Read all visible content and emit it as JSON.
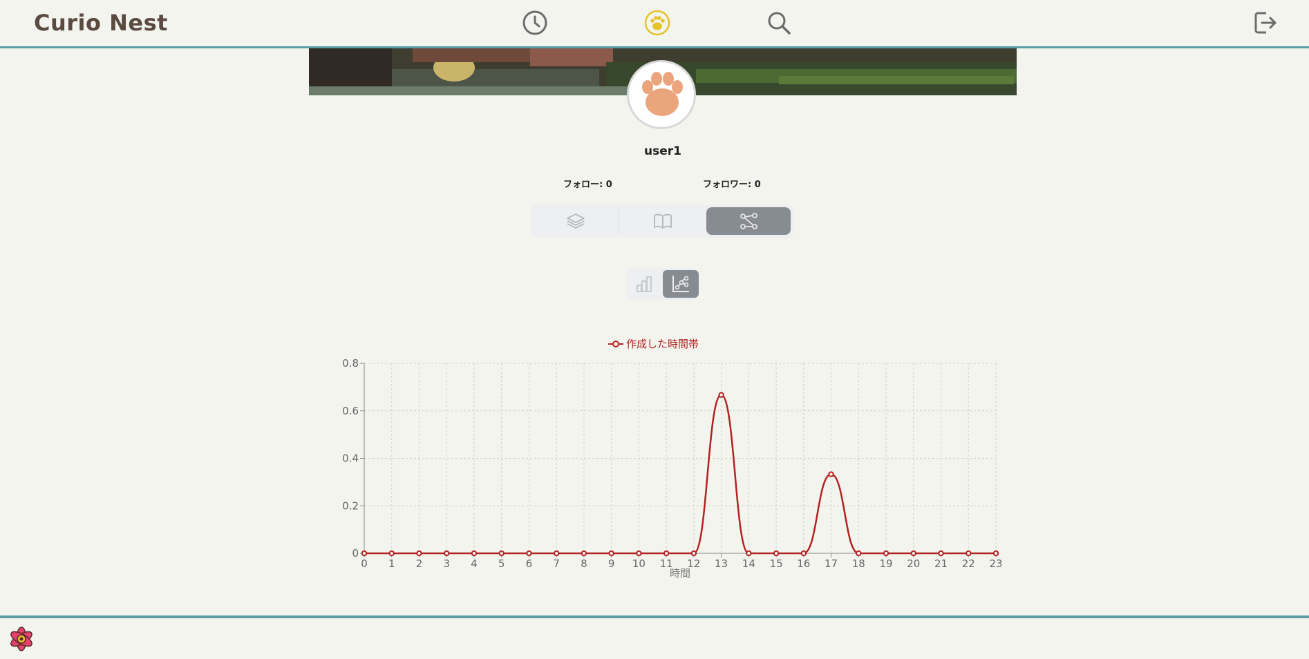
{
  "header": {
    "brand": "Curio Nest",
    "nav": {
      "history_icon": "clock-icon",
      "profile_icon": "paw-icon",
      "search_icon": "search-icon",
      "logout_icon": "logout-icon",
      "active_color": "#e6c229",
      "icon_color": "#6b6b6b"
    }
  },
  "profile": {
    "username": "user1",
    "follow_label": "フォロー: 0",
    "follower_label": "フォロワー: 0",
    "avatar_icon": "paw-icon",
    "avatar_color": "#eba57c"
  },
  "tabs": [
    {
      "name": "layers-icon",
      "active": false
    },
    {
      "name": "book-icon",
      "active": false
    },
    {
      "name": "graph-icon",
      "active": true
    }
  ],
  "subtabs": [
    {
      "name": "bar-chart-icon",
      "active": false
    },
    {
      "name": "line-chart-icon",
      "active": true
    }
  ],
  "chart_data": {
    "type": "line",
    "x": [
      0,
      1,
      2,
      3,
      4,
      5,
      6,
      7,
      8,
      9,
      10,
      11,
      12,
      13,
      14,
      15,
      16,
      17,
      18,
      19,
      20,
      21,
      22,
      23
    ],
    "series": [
      {
        "name": "作成した時間帯",
        "color": "#b22222",
        "values": [
          0,
          0,
          0,
          0,
          0,
          0,
          0,
          0,
          0,
          0,
          0,
          0,
          0,
          0.667,
          0,
          0,
          0,
          0.333,
          0,
          0,
          0,
          0,
          0,
          0
        ]
      }
    ],
    "xlabel": "時間",
    "ylabel": "",
    "ylim": [
      0,
      0.8
    ],
    "yticks": [
      "0",
      "0.2",
      "0.4",
      "0.6",
      "0.8"
    ],
    "grid": true,
    "legend_position": "top-center"
  },
  "footer": {
    "logo_icon": "flower-icon"
  }
}
